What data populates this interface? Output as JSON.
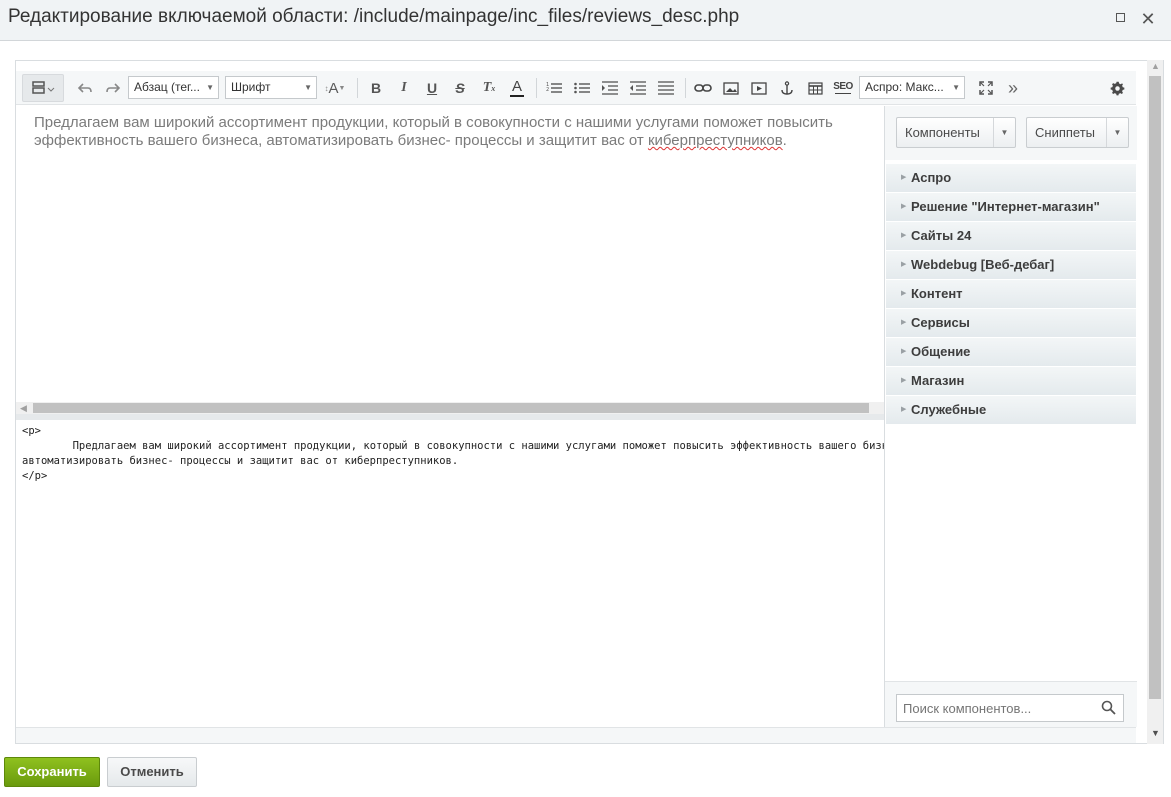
{
  "window": {
    "title": "Редактирование включаемой области: /include/mainpage/inc_files/reviews_desc.php"
  },
  "toolbar": {
    "paragraph_select": "Абзац (тег...",
    "font_select": "Шрифт",
    "font_size_label": "A",
    "bold": "B",
    "italic": "I",
    "underline": "U",
    "strike": "S",
    "clear_format": "T",
    "font_color": "A",
    "seo_label": "SEO",
    "template_select": "Аспро: Макс...",
    "more": "»"
  },
  "editor": {
    "text_before": "Предлагаем вам широкий ассортимент продукции, который в совокупности с нашими услугами поможет повысить эффективность вашего бизнеса, автоматизировать бизнес- процессы и защитит вас от ",
    "text_misspelled": "киберпреступников",
    "text_after": "."
  },
  "code": {
    "line1": "<p>",
    "line2": "\tПредлагаем вам широкий ассортимент продукции, который в совокупности с нашими услугами поможет повысить эффективность вашего бизне",
    "line3": "автоматизировать бизнес- процессы и защитит вас от киберпреступников.",
    "line4": "</p>"
  },
  "side_panel": {
    "components_button": "Компоненты",
    "snippets_button": "Сниппеты",
    "items": [
      {
        "label": "Аспро"
      },
      {
        "label": "Решение \"Интернет-магазин\""
      },
      {
        "label": "Сайты 24"
      },
      {
        "label": "Webdebug [Веб-дебаг]"
      },
      {
        "label": "Контент"
      },
      {
        "label": "Сервисы"
      },
      {
        "label": "Общение"
      },
      {
        "label": "Магазин"
      },
      {
        "label": "Служебные"
      }
    ],
    "search_placeholder": "Поиск компонентов..."
  },
  "footer": {
    "save_label": "Сохранить",
    "cancel_label": "Отменить"
  }
}
